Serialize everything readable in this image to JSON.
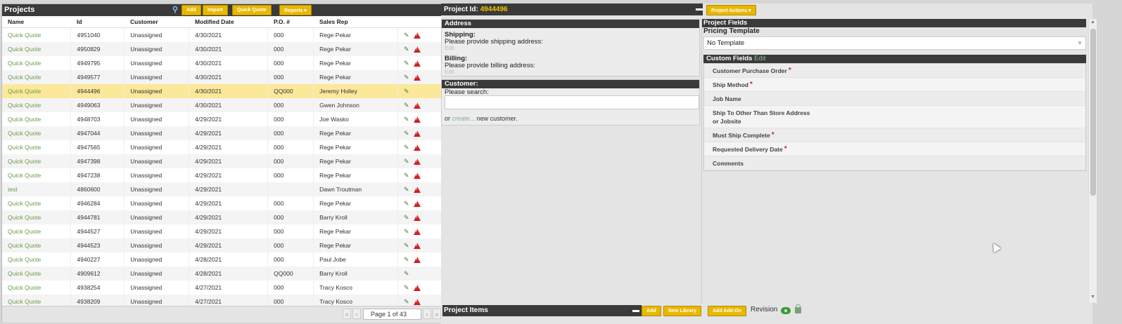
{
  "projects_panel": {
    "title": "Projects",
    "buttons": {
      "add": "Add",
      "import": "Import",
      "quick_quote": "Quick Quote",
      "reports": "Reports ▾"
    },
    "columns": [
      "Name",
      "Id",
      "Customer",
      "Modified Date",
      "P.O. #",
      "Sales Rep"
    ],
    "rows": [
      {
        "name": "Quick Quote",
        "id": "4951040",
        "customer": "Unassigned",
        "date": "4/30/2021",
        "po": "000",
        "rep": "Rege Pekar",
        "warn": true
      },
      {
        "name": "Quick Quote",
        "id": "4950829",
        "customer": "Unassigned",
        "date": "4/30/2021",
        "po": "000",
        "rep": "Rege Pekar",
        "warn": true
      },
      {
        "name": "Quick Quote",
        "id": "4949795",
        "customer": "Unassigned",
        "date": "4/30/2021",
        "po": "000",
        "rep": "Rege Pekar",
        "warn": true
      },
      {
        "name": "Quick Quote",
        "id": "4949577",
        "customer": "Unassigned",
        "date": "4/30/2021",
        "po": "000",
        "rep": "Rege Pekar",
        "warn": true
      },
      {
        "name": "Quick Quote",
        "id": "4944496",
        "customer": "Unassigned",
        "date": "4/30/2021",
        "po": "QQ000",
        "rep": "Jeremy Holley",
        "warn": false,
        "selected": true
      },
      {
        "name": "Quick Quote",
        "id": "4949063",
        "customer": "Unassigned",
        "date": "4/30/2021",
        "po": "000",
        "rep": "Gwen Johnson",
        "warn": true
      },
      {
        "name": "Quick Quote",
        "id": "4948703",
        "customer": "Unassigned",
        "date": "4/29/2021",
        "po": "000",
        "rep": "Joe Wasko",
        "warn": true
      },
      {
        "name": "Quick Quote",
        "id": "4947044",
        "customer": "Unassigned",
        "date": "4/29/2021",
        "po": "000",
        "rep": "Rege Pekar",
        "warn": true
      },
      {
        "name": "Quick Quote",
        "id": "4947565",
        "customer": "Unassigned",
        "date": "4/29/2021",
        "po": "000",
        "rep": "Rege Pekar",
        "warn": true
      },
      {
        "name": "Quick Quote",
        "id": "4947398",
        "customer": "Unassigned",
        "date": "4/29/2021",
        "po": "000",
        "rep": "Rege Pekar",
        "warn": true
      },
      {
        "name": "Quick Quote",
        "id": "4947238",
        "customer": "Unassigned",
        "date": "4/29/2021",
        "po": "000",
        "rep": "Rege Pekar",
        "warn": true
      },
      {
        "name": "test",
        "id": "4860600",
        "customer": "Unassigned",
        "date": "4/29/2021",
        "po": "",
        "rep": "Dawn Troutman",
        "warn": true
      },
      {
        "name": "Quick Quote",
        "id": "4946284",
        "customer": "Unassigned",
        "date": "4/29/2021",
        "po": "000",
        "rep": "Rege Pekar",
        "warn": true
      },
      {
        "name": "Quick Quote",
        "id": "4944781",
        "customer": "Unassigned",
        "date": "4/29/2021",
        "po": "000",
        "rep": "Barry Kroll",
        "warn": true
      },
      {
        "name": "Quick Quote",
        "id": "4944527",
        "customer": "Unassigned",
        "date": "4/29/2021",
        "po": "000",
        "rep": "Rege Pekar",
        "warn": true
      },
      {
        "name": "Quick Quote",
        "id": "4944523",
        "customer": "Unassigned",
        "date": "4/29/2021",
        "po": "000",
        "rep": "Rege Pekar",
        "warn": true
      },
      {
        "name": "Quick Quote",
        "id": "4940227",
        "customer": "Unassigned",
        "date": "4/28/2021",
        "po": "000",
        "rep": "Paul Jobe",
        "warn": true
      },
      {
        "name": "Quick Quote",
        "id": "4909612",
        "customer": "Unassigned",
        "date": "4/28/2021",
        "po": "QQ000",
        "rep": "Barry Kroll",
        "warn": false
      },
      {
        "name": "Quick Quote",
        "id": "4938254",
        "customer": "Unassigned",
        "date": "4/27/2021",
        "po": "000",
        "rep": "Tracy Kosco",
        "warn": true
      },
      {
        "name": "Quick Quote",
        "id": "4938209",
        "customer": "Unassigned",
        "date": "4/27/2021",
        "po": "000",
        "rep": "Tracy Kosco",
        "warn": true
      }
    ],
    "pager": {
      "text": "Page 1 of 43",
      "first": "«",
      "prev": "‹",
      "next": "›",
      "last": "»"
    }
  },
  "project": {
    "title_label": "Project Id:",
    "id": "4944496",
    "actions_button": "Project Actions ▾",
    "address": {
      "heading": "Address",
      "shipping_label": "Shipping:",
      "shipping_text": "Please provide shipping address:",
      "billing_label": "Billing:",
      "billing_text": "Please provide billing address:",
      "edit": "Edit"
    },
    "customer": {
      "heading": "Customer:",
      "search_label": "Please search:",
      "or": "or",
      "create": "create...",
      "new_customer": "new customer."
    },
    "fields": {
      "heading": "Project Fields",
      "pricing_template_label": "Pricing Template",
      "pricing_template_value": "No Template",
      "custom_fields_heading": "Custom Fields",
      "custom_fields_edit": "Edit",
      "custom": [
        {
          "label": "Customer Purchase Order",
          "required": true
        },
        {
          "label": "Ship Method",
          "required": true
        },
        {
          "label": "Job Name",
          "required": false
        },
        {
          "label": "Ship To Other Than Store Address",
          "label2": "or Jobsite",
          "required": false
        },
        {
          "label": "Must Ship Complete",
          "required": true
        },
        {
          "label": "Requested Delivery Date",
          "required": true
        },
        {
          "label": "Comments",
          "required": false
        }
      ]
    },
    "items": {
      "heading": "Project Items",
      "add": "Add",
      "item_library": "Item Library",
      "add_add_on": "Add Add-On",
      "revision": "Revision"
    }
  },
  "colors": {
    "accent": "#e8b800",
    "header": "#3a3a3a",
    "link": "#6b9a4a",
    "selected_row": "#fbe89a",
    "warning": "#d21f1f"
  }
}
